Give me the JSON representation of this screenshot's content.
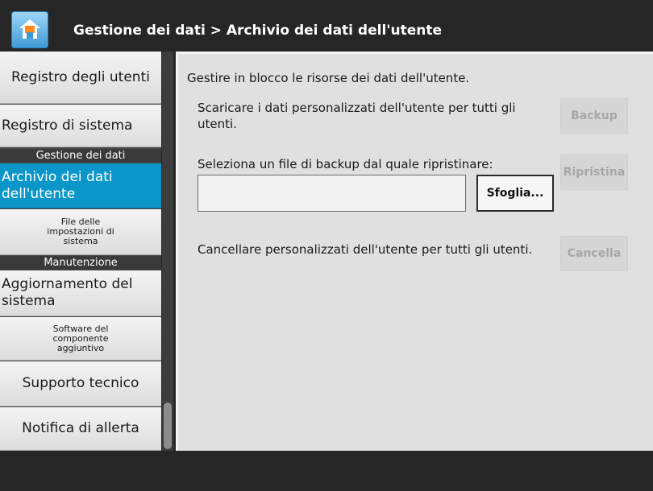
{
  "header": {
    "title": "Gestione dei dati > Archivio dei dati dell'utente",
    "home_icon": "home-icon"
  },
  "sidebar": {
    "items": [
      {
        "label": "Registro degli utenti"
      },
      {
        "label": "Registro di sistema"
      },
      {
        "section": "Gestione dei dati"
      },
      {
        "label": "Archivio dei dati dell'utente",
        "active": true
      },
      {
        "label": "File delle impostazioni di sistema"
      },
      {
        "section": "Manutenzione"
      },
      {
        "label": "Aggiornamento del sistema"
      },
      {
        "label": "Software del componente aggiuntivo"
      },
      {
        "label": "Supporto tecnico"
      },
      {
        "label": "Notifica di allerta"
      }
    ]
  },
  "main": {
    "intro": "Gestire in blocco le risorse dei dati dell'utente.",
    "backup_text": "Scaricare i dati personalizzati dell'utente per tutti gli utenti.",
    "backup_button": "Backup",
    "restore_text": "Seleziona un file di backup dal quale ripristinare:",
    "file_value": "",
    "browse_button": "Sfoglia...",
    "restore_button": "Ripristina",
    "delete_text": "Cancellare personalizzati dell'utente per tutti gli utenti.",
    "delete_button": "Cancella"
  },
  "colors": {
    "active_item": "#0a96c8",
    "titlebar": "#262626",
    "content_bg": "#e0e0e0"
  }
}
